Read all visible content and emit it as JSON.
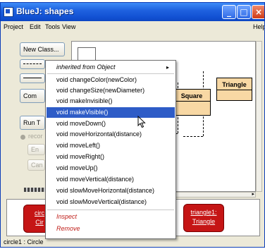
{
  "window": {
    "title": "BlueJ:  shapes"
  },
  "menubar": {
    "items": [
      "Project",
      "Edit",
      "Tools",
      "View"
    ],
    "help": "Help"
  },
  "left_panel": {
    "new_class": "New Class...",
    "compile": "Com",
    "run_tests": "Run T",
    "recording": "recor",
    "end": "En",
    "cancel": "Can"
  },
  "diagram": {
    "classes": [
      {
        "name": "Square"
      },
      {
        "name": "Triangle"
      }
    ]
  },
  "popup_menu": {
    "header": "inherited from Object",
    "submenu_arrow": "▸",
    "methods": [
      "void changeColor(newColor)",
      "void changeSize(newDiameter)",
      "void makeInvisible()",
      "void makeVisible()",
      "void moveDown()",
      "void moveHorizontal(distance)",
      "void moveLeft()",
      "void moveRight()",
      "void moveUp()",
      "void moveVertical(distance)",
      "void slowMoveHorizontal(distance)",
      "void slowMoveVertical(distance)"
    ],
    "selected_method": "void makeVisible()",
    "actions": [
      "Inspect",
      "Remove"
    ]
  },
  "object_bench": {
    "objects": [
      {
        "name": "circ",
        "type": "Cir"
      },
      {
        "name": "triangle1:",
        "type": "Triangle"
      }
    ]
  },
  "status": "circle1 : Circle",
  "colors": {
    "titlebar": "#1f62e0",
    "class_box": "#f8d8a4",
    "object": "#c51515",
    "selection": "#2e5cc7",
    "action_text": "#c0201b"
  }
}
